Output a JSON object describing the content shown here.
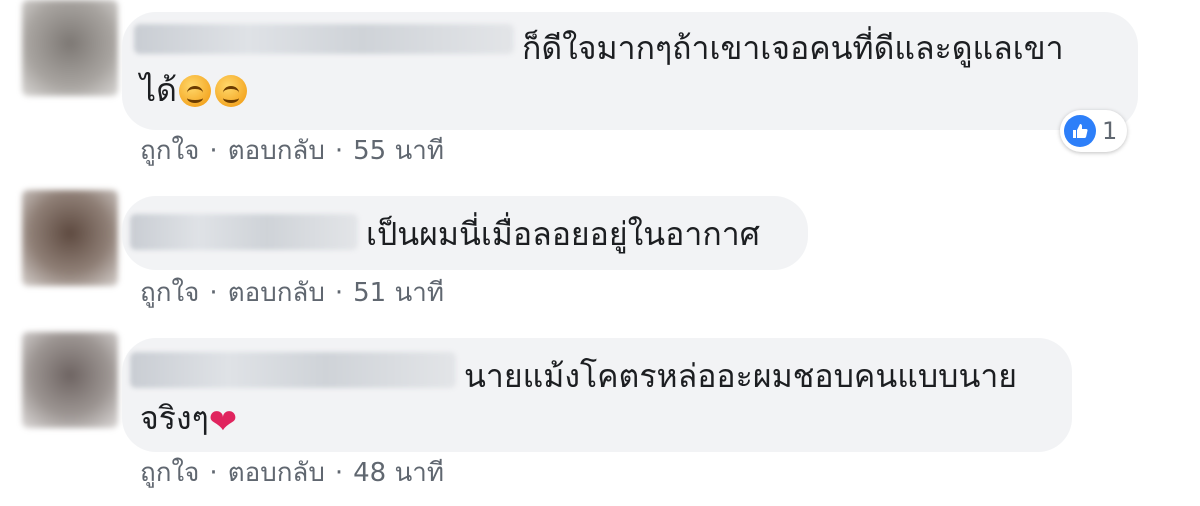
{
  "comments": [
    {
      "text_line1": "ก็ดีใจมากๆถ้าเขาเจอคนที่ดีและดูแลเขา",
      "text_line2": "ได้",
      "emoji": [
        "smiling-face-emoji",
        "smiling-face-emoji"
      ],
      "reaction": {
        "icon": "thumbs-up-icon",
        "count": "1"
      },
      "actions": {
        "like": "ถูกใจ",
        "reply": "ตอบกลับ",
        "time": "55 นาที"
      }
    },
    {
      "text_line1": "เป็นผมนี่เมื่อลอยอยู่ในอากาศ",
      "actions": {
        "like": "ถูกใจ",
        "reply": "ตอบกลับ",
        "time": "51 นาที"
      }
    },
    {
      "text_line1": "นายแม้งโคตรหล่ออะผมชอบคนแบบนาย",
      "text_line2": "จริงๆ",
      "emoji": [
        "red-heart-emoji"
      ],
      "actions": {
        "like": "ถูกใจ",
        "reply": "ตอบกลับ",
        "time": "48 นาที"
      }
    }
  ],
  "separator": "·",
  "colors": {
    "bubble": "#f2f3f5",
    "meta_text": "#606770",
    "like_blue": "#2d7ff9",
    "heart_red": "#e0245e"
  }
}
